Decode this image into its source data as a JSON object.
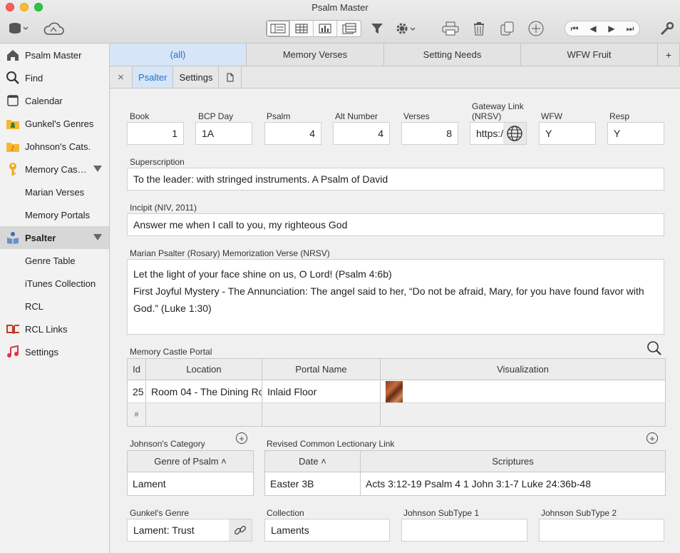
{
  "window": {
    "title": "Psalm Master"
  },
  "sidebar": {
    "items": [
      {
        "label": "Psalm Master",
        "icon": "home-icon"
      },
      {
        "label": "Find",
        "icon": "magnifier-icon"
      },
      {
        "label": "Calendar",
        "icon": "calendar-icon"
      },
      {
        "label": "Gunkel's Genres",
        "icon": "folder-person-icon"
      },
      {
        "label": "Johnson's Cats.",
        "icon": "folder-music-icon"
      },
      {
        "label": "Memory Cas…",
        "icon": "key-icon"
      },
      {
        "label": "Marian Verses"
      },
      {
        "label": "Memory Portals"
      },
      {
        "label": "Psalter",
        "icon": "reader-icon"
      },
      {
        "label": "Genre Table"
      },
      {
        "label": "iTunes Collection"
      },
      {
        "label": "RCL"
      },
      {
        "label": "RCL Links",
        "icon": "open-book-icon"
      },
      {
        "label": "Settings",
        "icon": "music-note-icon"
      }
    ]
  },
  "tabs": [
    "(all)",
    "Memory Verses",
    "Setting Needs",
    "WFW Fruit",
    "+"
  ],
  "subtabs": {
    "close": "×",
    "psalter": "Psalter",
    "settings": "Settings"
  },
  "fields": {
    "book": {
      "label": "Book",
      "value": "1"
    },
    "bcp_day": {
      "label": "BCP Day",
      "value": "1A"
    },
    "psalm": {
      "label": "Psalm",
      "value": "4"
    },
    "alt_number": {
      "label": "Alt Number",
      "value": "4"
    },
    "verses": {
      "label": "Verses",
      "value": "8"
    },
    "gateway": {
      "label_line1": "Gateway Link",
      "label_line2": "(NRSV)",
      "value": "https:/"
    },
    "wfw": {
      "label": "WFW",
      "value": "Y"
    },
    "resp": {
      "label": "Resp",
      "value": "Y"
    },
    "superscription": {
      "label": "Superscription",
      "value": "To the leader: with stringed instruments. A Psalm of David"
    },
    "incipit": {
      "label": "Incipit (NIV, 2011)",
      "value": "Answer me when I call to you, my righteous God"
    },
    "marian": {
      "label": "Marian Psalter (Rosary) Memorization Verse (NRSV)",
      "line1": "Let the light of your face shine on us, O Lord! (Psalm 4:6b)",
      "line2": "First Joyful Mystery - The Annunciation: The angel said to her, “Do not be afraid, Mary, for you have found favor with",
      "line3": "God.” (Luke 1:30)"
    }
  },
  "portal": {
    "label": "Memory Castle Portal",
    "headers": [
      "Id",
      "Location",
      "Portal Name",
      "Visualization"
    ],
    "row": {
      "id": "25",
      "location": "Room 04 - The Dining Ro",
      "portal_name": "Inlaid Floor"
    },
    "new_row_marker": "#"
  },
  "johnson": {
    "label": "Johnson's Category",
    "header": "Genre of Psalm ˄",
    "value": "Lament"
  },
  "rcl": {
    "label": "Revised Common Lectionary Link",
    "headers": [
      "Date ˄",
      "Scriptures"
    ],
    "row": {
      "date": "Easter 3B",
      "scriptures": "Acts 3:12-19 Psalm 4 1 John 3:1-7 Luke 24:36b-48"
    }
  },
  "bottom": {
    "gunkel": {
      "label": "Gunkel's Genre",
      "value": "Lament: Trust"
    },
    "collection": {
      "label": "Collection",
      "value": "Laments"
    },
    "johnson_sub1": {
      "label": "Johnson SubType 1",
      "value": ""
    },
    "johnson_sub2": {
      "label": "Johnson SubType 2",
      "value": ""
    }
  }
}
